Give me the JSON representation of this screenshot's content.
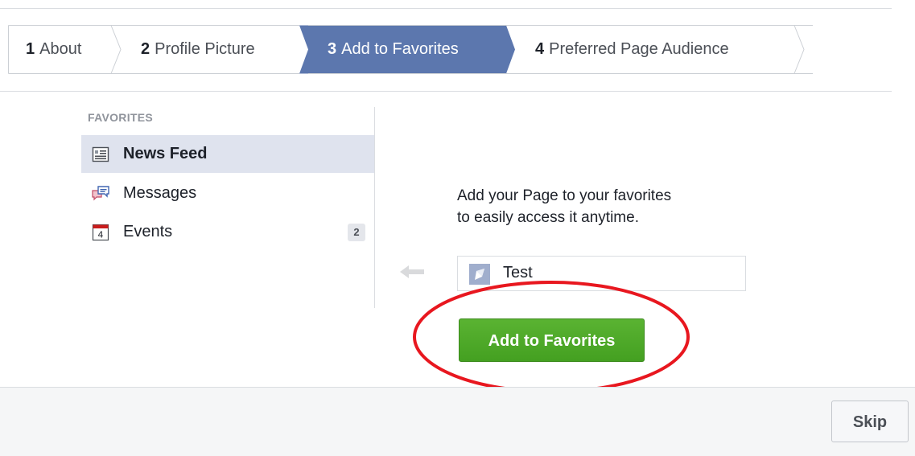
{
  "steps": [
    {
      "num": "1",
      "label": "About"
    },
    {
      "num": "2",
      "label": "Profile Picture"
    },
    {
      "num": "3",
      "label": "Add to Favorites"
    },
    {
      "num": "4",
      "label": "Preferred Page Audience"
    }
  ],
  "active_step": 3,
  "favorites": {
    "title": "FAVORITES",
    "items": [
      {
        "label": "News Feed",
        "icon": "news-feed-icon",
        "selected": true
      },
      {
        "label": "Messages",
        "icon": "messages-icon"
      },
      {
        "label": "Events",
        "icon": "events-calendar-icon",
        "calendar_day": "4",
        "badge": "2"
      }
    ]
  },
  "prompt": {
    "line1": "Add your Page to your favorites",
    "line2": "to easily access it anytime."
  },
  "page_chip": {
    "label": "Test",
    "icon": "page-flag-icon"
  },
  "add_button_label": "Add to Favorites",
  "skip_label": "Skip",
  "colors": {
    "active_step": "#5c77ae",
    "add_button": "#4caf28",
    "annotation_ring": "#e8171f",
    "selected_row": "#dfe3ee"
  }
}
